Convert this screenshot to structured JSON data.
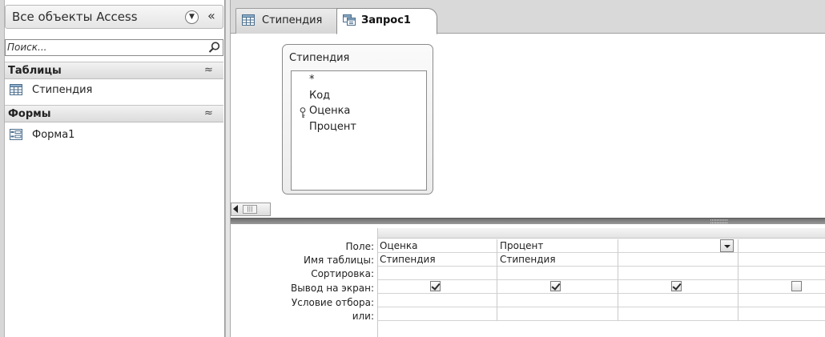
{
  "nav": {
    "title": "Все объекты Access",
    "dropdown_icon": "chevron-down-circle-icon",
    "collapse_glyph": "«",
    "search_placeholder": "Поиск...",
    "groups": [
      {
        "label": "Таблицы",
        "chevron": "⌃",
        "items": [
          {
            "label": "Стипендия",
            "icon": "table-icon"
          }
        ]
      },
      {
        "label": "Формы",
        "chevron": "⌃",
        "items": [
          {
            "label": "Форма1",
            "icon": "form-icon"
          }
        ]
      }
    ]
  },
  "tabs": [
    {
      "label": "Стипендия",
      "icon": "table-icon",
      "active": false
    },
    {
      "label": "Запрос1",
      "icon": "query-icon",
      "active": true
    }
  ],
  "table_box": {
    "title": "Стипендия",
    "fields": [
      {
        "label": "*",
        "key": false
      },
      {
        "label": "Код",
        "key": false
      },
      {
        "label": "Оценка",
        "key": true
      },
      {
        "label": "Процент",
        "key": false
      }
    ]
  },
  "grid": {
    "row_labels": [
      "Поле:",
      "Имя таблицы:",
      "Сортировка:",
      "Вывод на экран:",
      "Условие отбора:",
      "или:"
    ],
    "columns": [
      {
        "field": "Оценка",
        "table": "Стипендия",
        "show": true
      },
      {
        "field": "Процент",
        "table": "Стипендия",
        "show": true
      },
      {
        "field": "",
        "table": "",
        "show": true,
        "dropdown": true
      },
      {
        "field": "",
        "table": "",
        "show": false
      }
    ]
  },
  "colors": {
    "chrome": "#d9d9d9",
    "border": "#9a9a9a",
    "splitter": "#7a7a7a"
  }
}
